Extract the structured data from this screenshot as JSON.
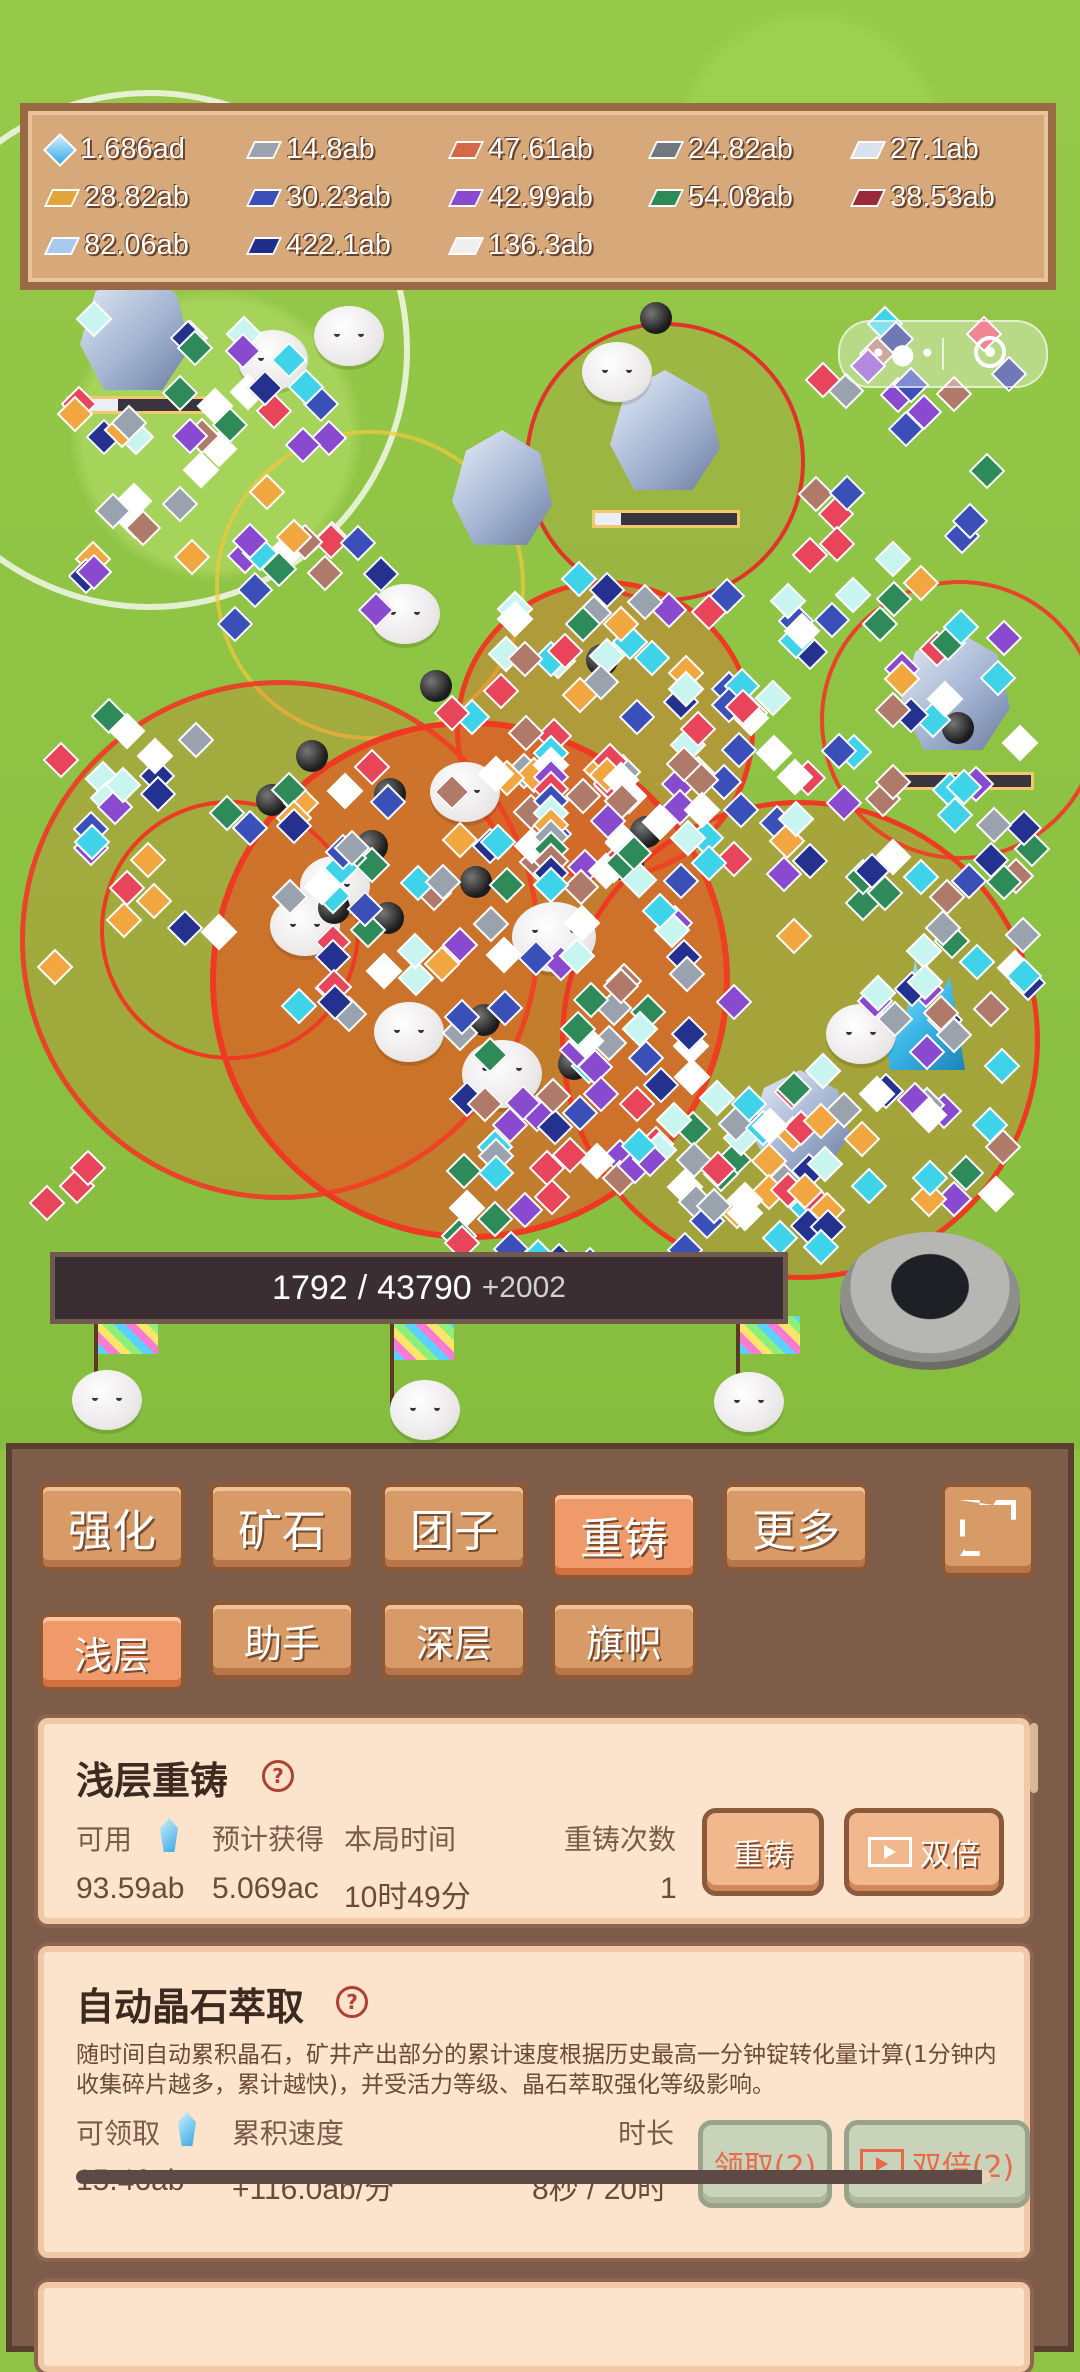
{
  "resources": [
    {
      "icon": "crystal-icon",
      "value": "1.686ad",
      "color": "#5fb6f0"
    },
    {
      "icon": "silver-ingot-icon",
      "value": "14.8ab",
      "color": "#9aa3ad"
    },
    {
      "icon": "copper-ingot-icon",
      "value": "47.61ab",
      "color": "#d36a45"
    },
    {
      "icon": "iron-ingot-icon",
      "value": "24.82ab",
      "color": "#6f7880"
    },
    {
      "icon": "platinum-ingot-icon",
      "value": "27.1ab",
      "color": "#d9e1ea"
    },
    {
      "icon": "gold-ingot-icon",
      "value": "28.82ab",
      "color": "#e3a43a"
    },
    {
      "icon": "sapphire-ingot-icon",
      "value": "30.23ab",
      "color": "#3a4fb8"
    },
    {
      "icon": "amethyst-ingot-icon",
      "value": "42.99ab",
      "color": "#8a4ad0"
    },
    {
      "icon": "emerald-ingot-icon",
      "value": "54.08ab",
      "color": "#2f8a5a"
    },
    {
      "icon": "ruby-ingot-icon",
      "value": "38.53ab",
      "color": "#9a2a3a"
    },
    {
      "icon": "diamond-ingot-icon",
      "value": "82.06ab",
      "color": "#a9c9f0"
    },
    {
      "icon": "cobalt-ingot-icon",
      "value": "422.1ab",
      "color": "#1f2e8a"
    },
    {
      "icon": "pearl-ingot-icon",
      "value": "136.3ab",
      "color": "#f1eef2"
    }
  ],
  "progress": {
    "current": "1792",
    "separator": "/",
    "target": "43790",
    "gain": "+2002"
  },
  "tabs": [
    "强化",
    "矿石",
    "团子",
    "重铸",
    "更多"
  ],
  "active_tab": "重铸",
  "subtabs": [
    "浅层",
    "助手",
    "深层",
    "旗帜"
  ],
  "active_subtab": "浅层",
  "reforge_card": {
    "title": "浅层重铸",
    "help": "?",
    "labels": {
      "available": "可用",
      "expected": "预计获得",
      "session_time": "本局时间",
      "count": "重铸次数"
    },
    "values": {
      "available": "93.59ab",
      "expected": "5.069ac",
      "session_time": "10时49分",
      "count": "1"
    },
    "button": "重铸",
    "double_button": "双倍"
  },
  "auto_card": {
    "title": "自动晶石萃取",
    "help": "?",
    "description": "随时间自动累积晶石，矿井产出部分的累计速度根据历史最高一分钟锭转化量计算(1分钟内收集碎片越多，累计越快)，并受活力等级、晶石萃取强化等级影响。",
    "labels": {
      "claimable": "可领取",
      "rate": "累积速度",
      "duration": "时长"
    },
    "values": {
      "claimable": "15.46ab",
      "rate": "+116.0ab/分",
      "duration": "8秒 / 20时"
    },
    "claim_button": "领取(2)",
    "double_button": "双倍(2)",
    "accumulation_progress": 0.99
  },
  "colors": {
    "panel": "#7d5c4a",
    "card": "#fbe3cc",
    "tab": "#d89b68",
    "active_tab": "#f09a6c",
    "grass": "#8fc246"
  }
}
